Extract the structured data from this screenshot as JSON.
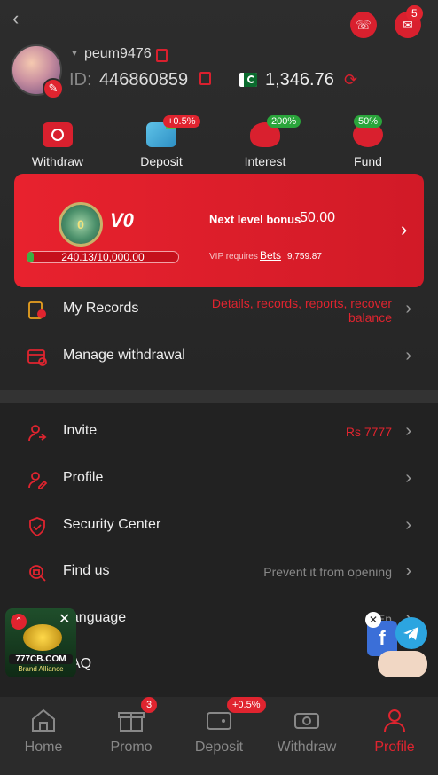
{
  "header": {
    "back_icon": "chevron-left-icon",
    "support_icon": "headset-icon",
    "messages_icon": "mail-icon",
    "messages_badge": "5"
  },
  "profile": {
    "username": "peum9476",
    "id_label": "ID:",
    "id_value": "446860859",
    "flag_icon": "pakistan-flag-icon",
    "balance": "1,346.76"
  },
  "quick_actions": [
    {
      "label": "Withdraw",
      "icon": "withdraw-icon",
      "badge": ""
    },
    {
      "label": "Deposit",
      "icon": "deposit-icon",
      "badge": "+0.5%"
    },
    {
      "label": "Interest",
      "icon": "piggy-bank-icon",
      "badge": "200%"
    },
    {
      "label": "Fund",
      "icon": "fund-icon",
      "badge": "50%"
    }
  ],
  "vip": {
    "level": "V0",
    "medal_text": "0",
    "progress_text": "240.13/10,000.00",
    "progress": 0.024,
    "next_bonus_label": "Next level bonus",
    "next_bonus_value": "50.00",
    "requires_label": "VIP requires",
    "bets_link": "Bets",
    "bets_value": "9,759.87"
  },
  "menu_group1": [
    {
      "label": "My Records",
      "value": "Details, records, reports, recover",
      "value2": "balance",
      "icon": "records-icon"
    },
    {
      "label": "Manage withdrawal",
      "value": "",
      "icon": "card-settings-icon"
    }
  ],
  "menu_group2": [
    {
      "label": "Invite",
      "value": "Rs 7777",
      "icon": "invite-icon"
    },
    {
      "label": "Profile",
      "value": "",
      "icon": "profile-edit-icon"
    },
    {
      "label": "Security Center",
      "value": "",
      "icon": "shield-icon"
    },
    {
      "label": "Find us",
      "value": "Prevent it from opening",
      "icon": "search-doc-icon"
    },
    {
      "label": "Language",
      "value": "En",
      "icon": "language-icon"
    },
    {
      "label": "FAQ",
      "value": "",
      "icon": "faq-icon"
    }
  ],
  "float_banner": {
    "brand": "777CB.COM",
    "subtitle": "Brand Alliance"
  },
  "nav": [
    {
      "label": "Home",
      "icon": "home-icon",
      "badge": ""
    },
    {
      "label": "Promo",
      "icon": "gift-icon",
      "badge": "3"
    },
    {
      "label": "Deposit",
      "icon": "wallet-icon",
      "badge": "+0.5%"
    },
    {
      "label": "Withdraw",
      "icon": "withdraw-icon",
      "badge": ""
    },
    {
      "label": "Profile",
      "icon": "user-icon",
      "badge": ""
    }
  ],
  "colors": {
    "accent": "#e0242f",
    "bg": "#222222",
    "green": "#2aa53b"
  }
}
